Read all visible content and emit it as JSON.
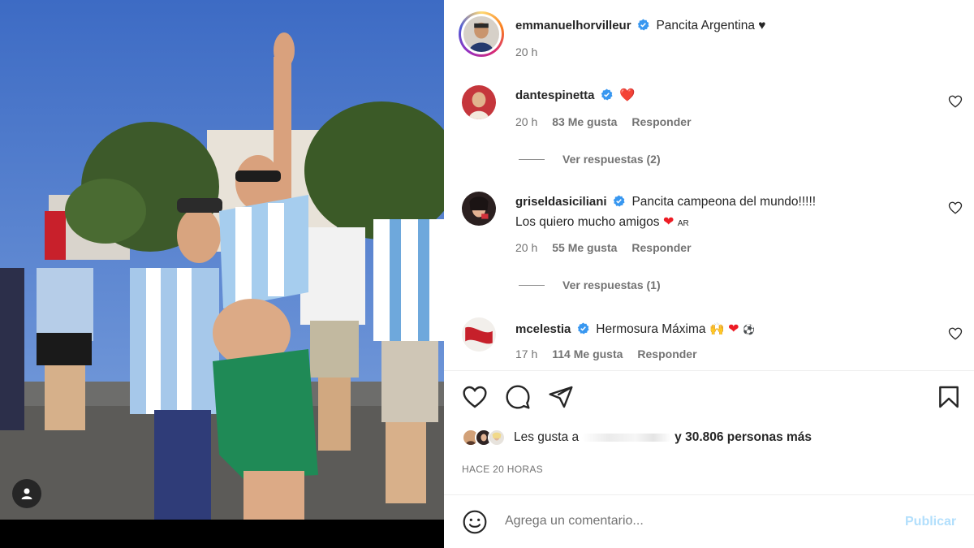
{
  "post": {
    "author": "emmanuelhorvilleur",
    "caption": "Pancita Argentina ♥",
    "time": "20 h"
  },
  "comments": [
    {
      "user": "dantespinetta",
      "text": "❤️",
      "time": "20 h",
      "likes": "83 Me gusta",
      "reply": "Responder",
      "view_replies": "Ver respuestas (2)"
    },
    {
      "user": "griseldasiciliani",
      "text_line1": "Pancita campeona del mundo!!!!!",
      "text_line2": "Los quiero mucho amigos",
      "text_line2_suffix": "AR",
      "time": "20 h",
      "likes": "55 Me gusta",
      "reply": "Responder",
      "view_replies": "Ver respuestas (1)"
    },
    {
      "user": "mcelestia",
      "text": "Hermosura Máxima",
      "time": "17 h",
      "likes": "114 Me gusta",
      "reply": "Responder"
    }
  ],
  "actions": {
    "like_icon": "heart-outline-icon",
    "comment_icon": "comment-bubble-icon",
    "share_icon": "paper-plane-icon",
    "save_icon": "bookmark-icon"
  },
  "likes": {
    "prefix": "Les gusta a",
    "suffix": "y 30.806 personas más"
  },
  "timestamp": "HACE 20 HORAS",
  "composer": {
    "placeholder": "Agrega un comentario...",
    "publish_label": "Publicar"
  },
  "colors": {
    "verified": "#3897f0",
    "heart": "#ed1c24",
    "publish_disabled": "#b2dffc",
    "meta_text": "#737373"
  }
}
